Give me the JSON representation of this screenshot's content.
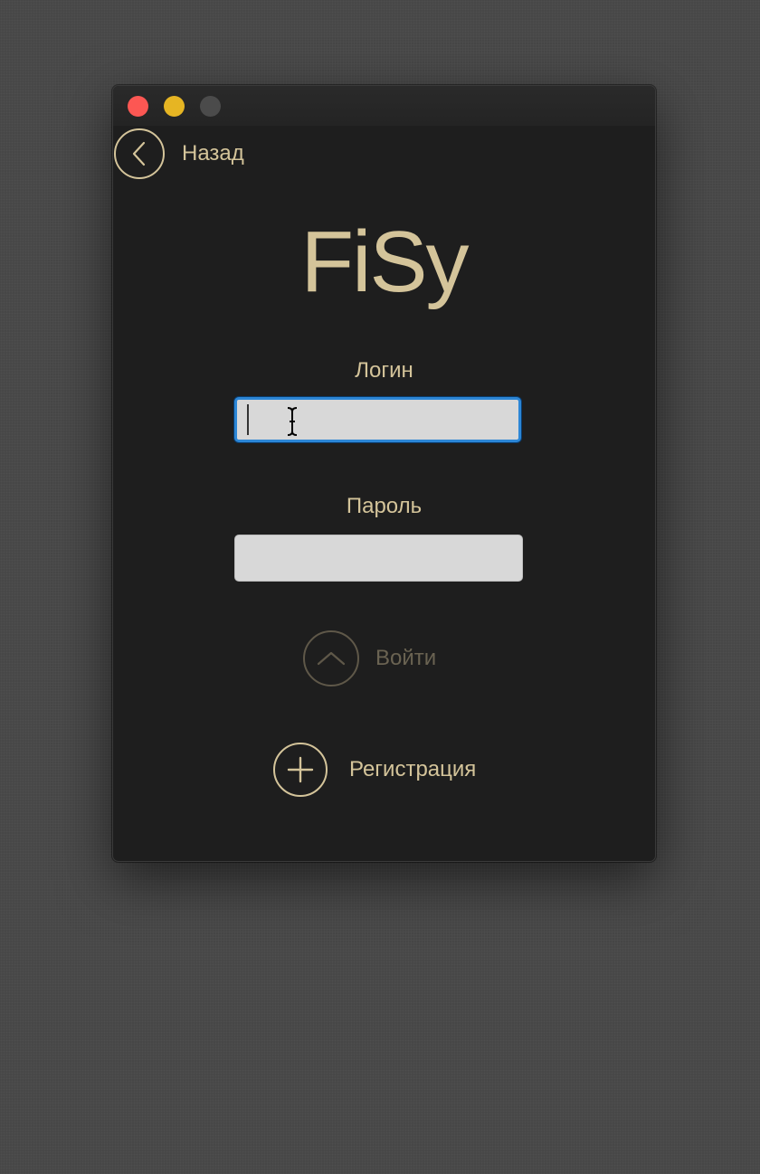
{
  "window": {
    "controls": [
      "close",
      "minimize",
      "maximize"
    ]
  },
  "nav": {
    "back_label": "Назад",
    "back_icon": "chevron-left-icon"
  },
  "app": {
    "logo_text": "FiSy"
  },
  "form": {
    "login_label": "Логин",
    "login_value": "",
    "password_label": "Пароль",
    "password_value": "",
    "submit_label": "Войти",
    "submit_icon": "chevron-up-icon",
    "submit_enabled": false,
    "register_label": "Регистрация",
    "register_icon": "plus-icon"
  },
  "colors": {
    "accent": "#d4c49a",
    "accent_disabled": "#6a6352",
    "window_bg": "#1e1e1e",
    "desktop_bg": "#474747",
    "focus_ring": "#2c86d6",
    "field_bg": "#d8d8d8",
    "close": "#fc5753",
    "minimize": "#e6b523",
    "maximize_inactive": "#4b4b4b"
  }
}
